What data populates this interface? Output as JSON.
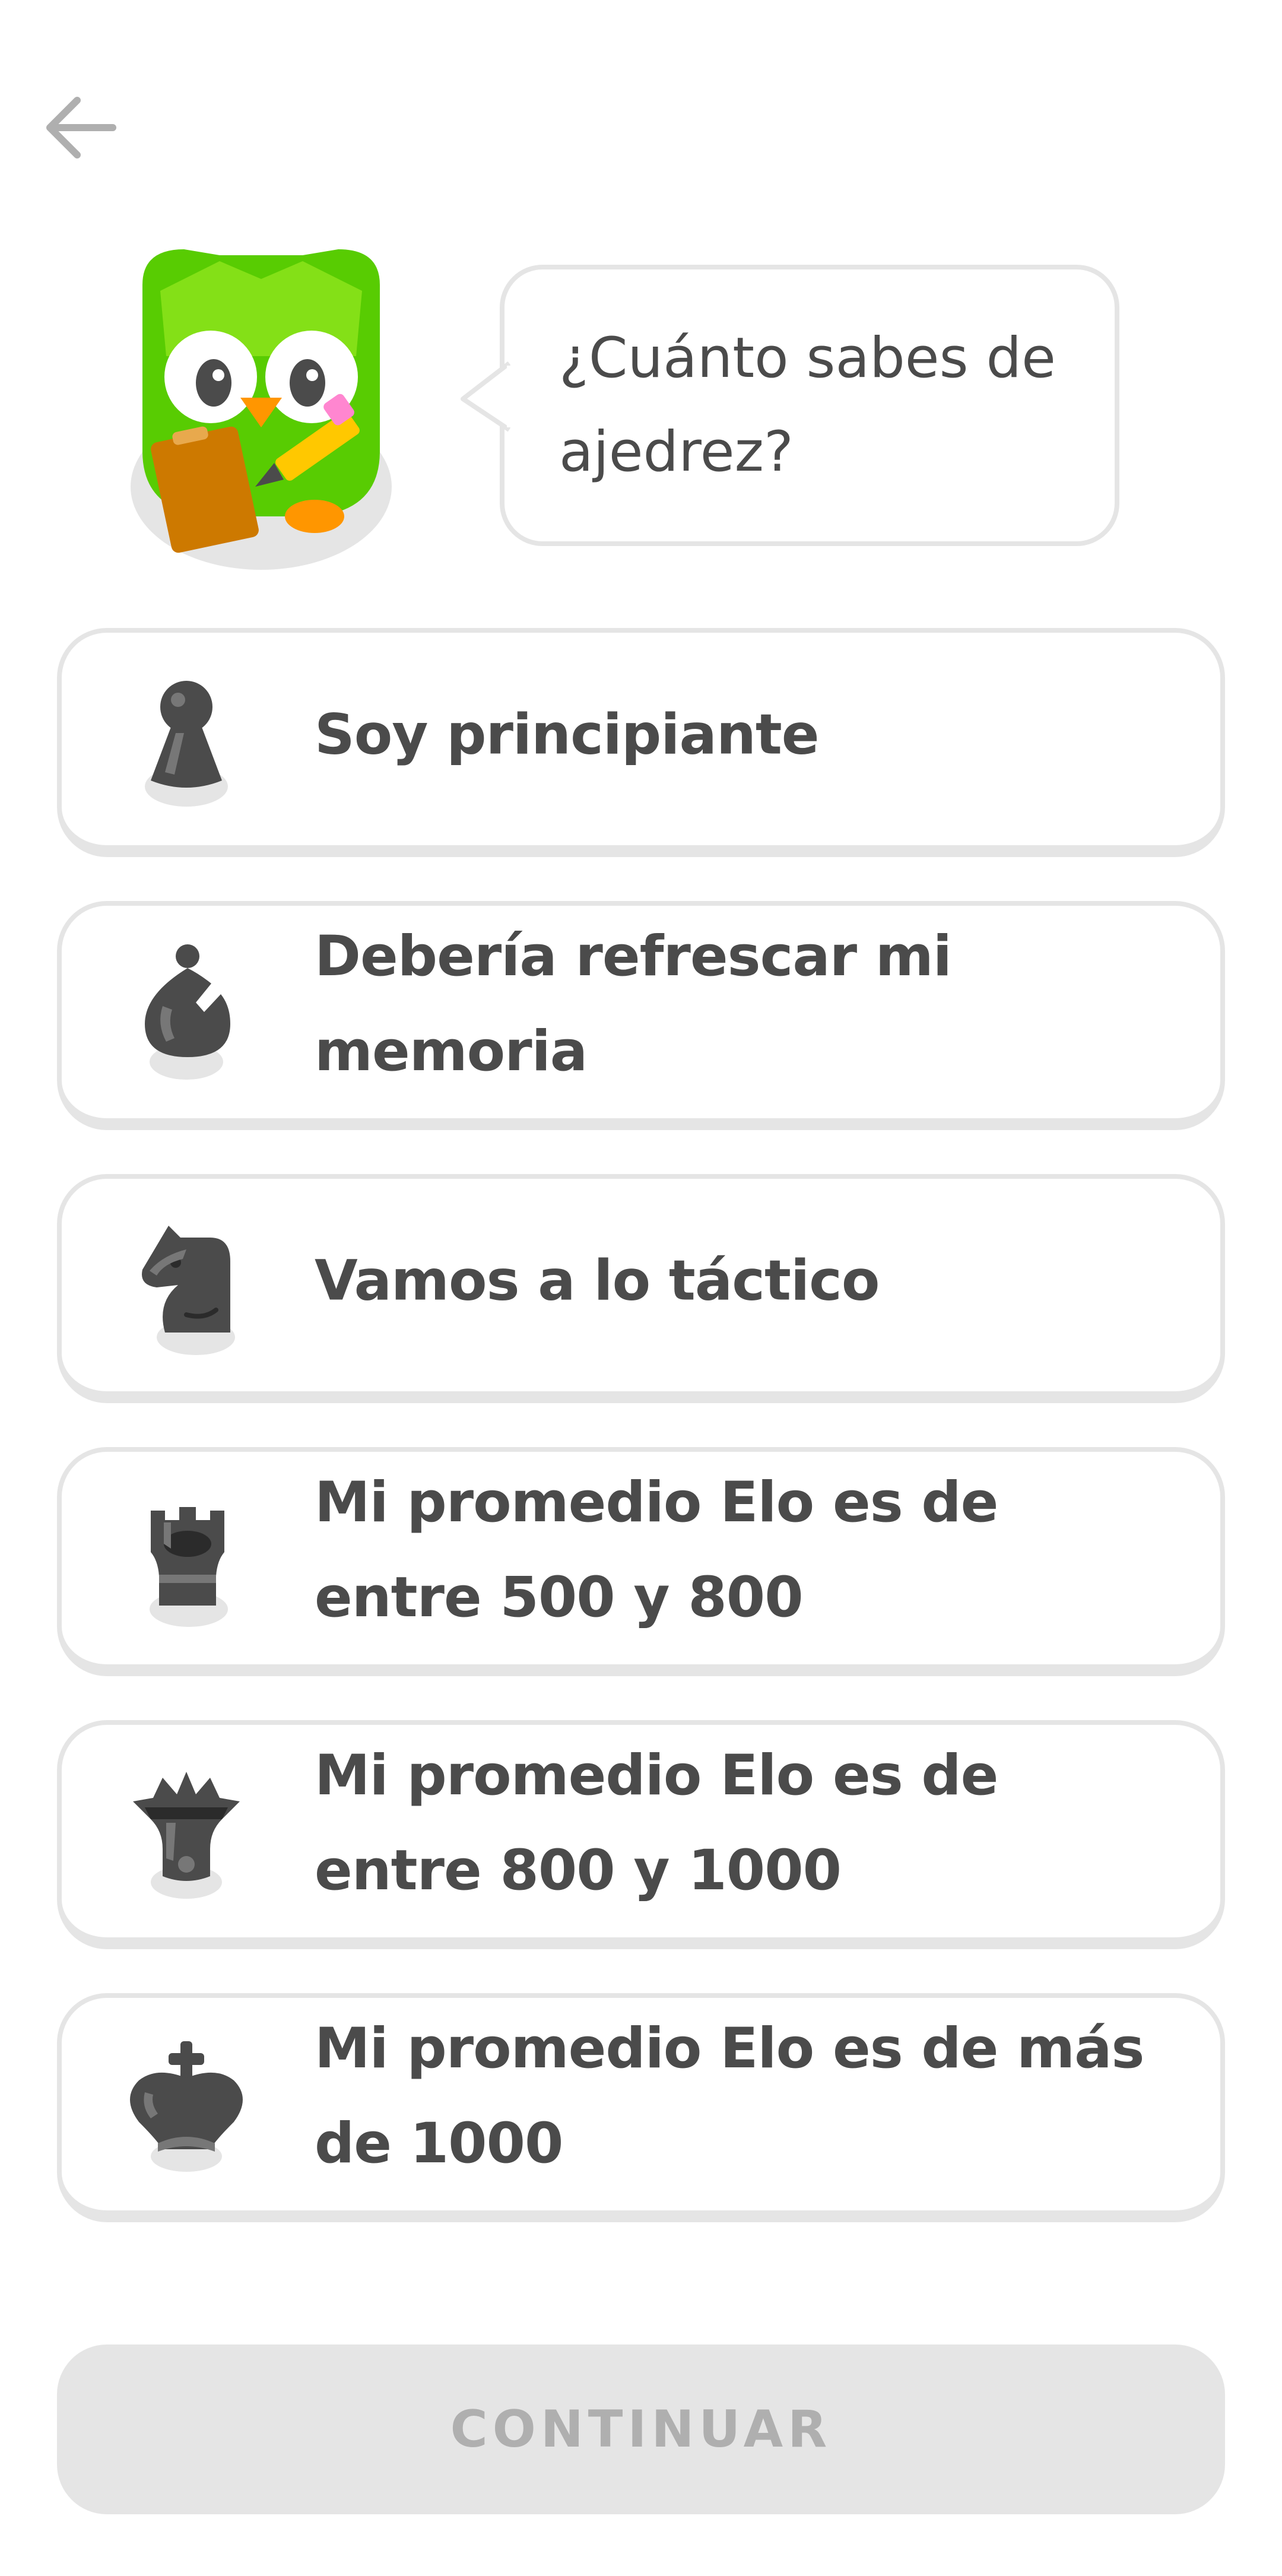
{
  "header": {
    "back_icon": "arrow-left-icon"
  },
  "prompt": {
    "mascot_icon": "owl-mascot-icon",
    "question": "¿Cuánto sabes de ajedrez?"
  },
  "options": [
    {
      "icon": "chess-pawn-icon",
      "label": "Soy principiante"
    },
    {
      "icon": "chess-bishop-icon",
      "label": "Debería refrescar mi memoria"
    },
    {
      "icon": "chess-knight-icon",
      "label": "Vamos a lo táctico"
    },
    {
      "icon": "chess-rook-icon",
      "label": "Mi promedio Elo es de entre 500 y 800"
    },
    {
      "icon": "chess-queen-icon",
      "label": "Mi promedio Elo es de entre 800 y 1000"
    },
    {
      "icon": "chess-king-icon",
      "label": "Mi promedio Elo es de más de 1000"
    }
  ],
  "footer": {
    "continue_label": "CONTINUAR",
    "continue_enabled": false
  },
  "colors": {
    "text": "#4b4b4b",
    "border": "#e5e5e5",
    "owl_green": "#58cc02",
    "piece_gray": "#4b4b4b",
    "disabled_text": "#afafaf"
  }
}
